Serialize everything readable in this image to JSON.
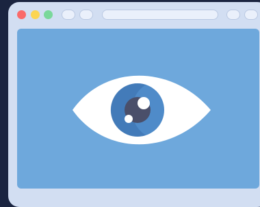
{
  "window": {
    "traffic_lights": {
      "close_color": "#fa6a6a",
      "minimize_color": "#fcd553",
      "maximize_color": "#7ad89a"
    },
    "tabs": [
      "",
      ""
    ],
    "address_bar": {
      "value": ""
    },
    "actions": [
      "",
      ""
    ]
  },
  "content": {
    "background_color": "#6ea8dc",
    "illustration": {
      "icon": "eye-icon",
      "sclera_color": "#ffffff",
      "iris_color": "#4f8bc9",
      "pupil_color": "#4a4f6a"
    }
  }
}
